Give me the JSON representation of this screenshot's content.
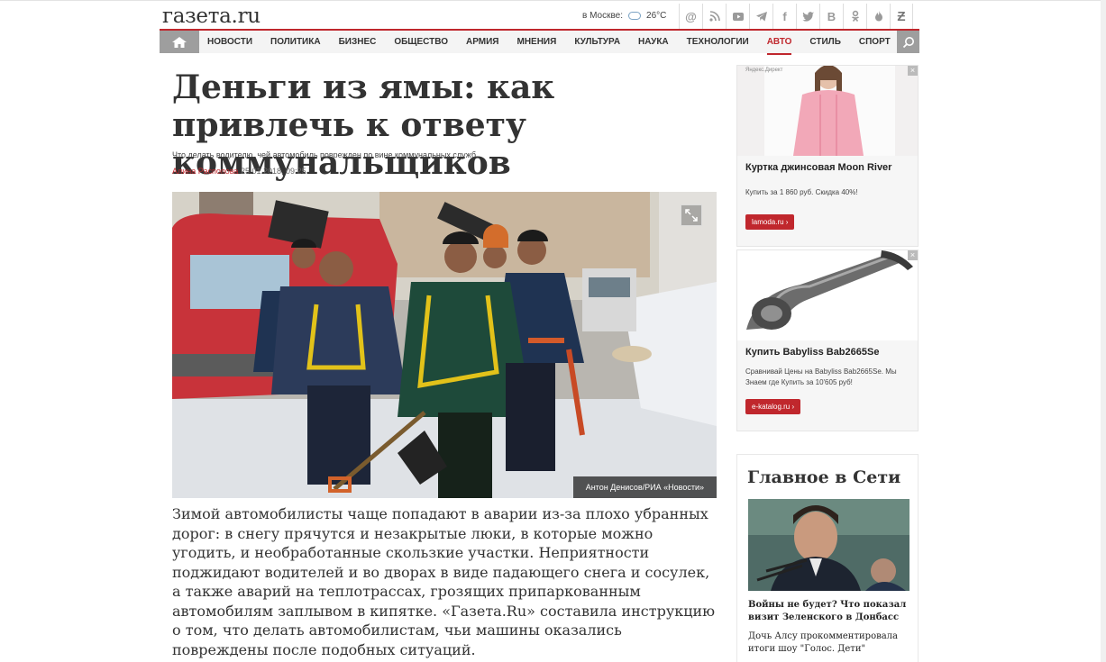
{
  "site": {
    "logo": "газета.ru"
  },
  "weather": {
    "label": "в Москве:",
    "icon": "cloud-icon",
    "temp": "26°C"
  },
  "social": [
    "at-icon",
    "rss-icon",
    "youtube-icon",
    "telegram-icon",
    "facebook-icon",
    "twitter-icon",
    "vk-icon",
    "odnoklassniki-icon",
    "fire-icon",
    "zen-icon"
  ],
  "nav": {
    "items": [
      "НОВОСТИ",
      "ПОЛИТИКА",
      "БИЗНЕС",
      "ОБЩЕСТВО",
      "АРМИЯ",
      "МНЕНИЯ",
      "КУЛЬТУРА",
      "НАУКА",
      "ТЕХНОЛОГИИ",
      "АВТО",
      "СТИЛЬ",
      "СПОРТ"
    ],
    "active": "АВТО"
  },
  "article": {
    "headline": "Деньги из ямы: как привлечь к ответу коммунальщиков",
    "subtitle": "Что делать водителю, чей автомобиль поврежден по вине коммунальных служб",
    "author": "Алина Распопова",
    "date": "25.01.2018, 09:25",
    "photo_credit": "Антон Денисов/РИА «Новости»",
    "body": "Зимой автомобилисты чаще попадают в аварии из-за плохо убранных дорог: в снегу прячутся и незакрытые люки, в которые можно угодить, и необработанные скользкие участки. Неприятности поджидают водителей и во дворах в виде падающего снега и сосулек, а также аварий на теплотрассах, грозящих припаркованным автомобилям заплывом в кипятке. «Газета.Ru» составила инструкцию о том, что делать автомобилистам, чьи машины оказались повреждены после подобных ситуаций."
  },
  "ads": [
    {
      "label": "Яндекс.Директ",
      "title": "Куртка джинсовая Moon River",
      "desc": "Купить за 1 860 руб. Скидка 40%!",
      "button": "lamoda.ru ›"
    },
    {
      "label": "",
      "title": "Купить Babyliss Bab2665Se",
      "desc": "Сравнивай Цены на Babyliss Bab2665Se. Мы Знаем где Купить за 10'605 руб!",
      "button": "e-katalog.ru ›"
    }
  ],
  "main_box": {
    "title": "Главное в Сети",
    "news1": "Войны не будет? Что показал визит Зеленского в Донбасс",
    "news2": "Дочь Алсу прокомментировала итоги шоу \"Голос. Дети\""
  }
}
